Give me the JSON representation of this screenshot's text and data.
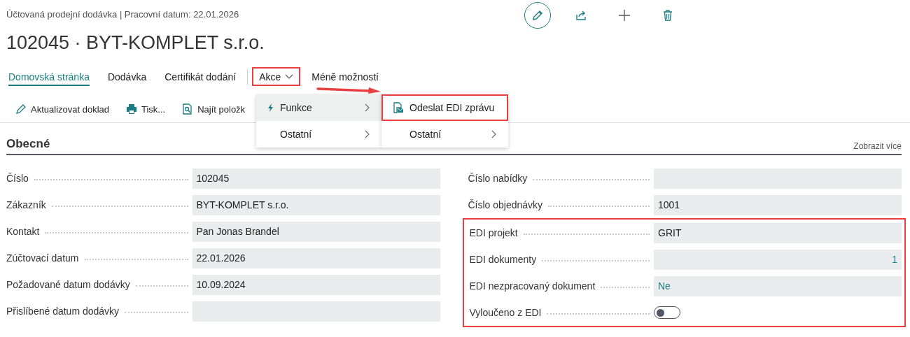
{
  "header": {
    "subtitle": "Účtovaná prodejní dodávka | Pracovní datum: 22.01.2026",
    "title": "102045 · BYT-KOMPLET s.r.o.",
    "tools": [
      {
        "kind": "edit",
        "selected": true
      },
      {
        "kind": "share",
        "selected": false
      },
      {
        "kind": "add",
        "selected": false
      },
      {
        "kind": "delete",
        "selected": false
      }
    ]
  },
  "tabs": [
    {
      "label": "Domovská stránka",
      "selected": true,
      "highlighted": false,
      "kind": "tab"
    },
    {
      "label": "Dodávka",
      "selected": false,
      "highlighted": false,
      "kind": "tab"
    },
    {
      "label": "Certifikát dodání",
      "selected": false,
      "highlighted": false,
      "kind": "tab"
    },
    {
      "label": "Akce",
      "selected": false,
      "highlighted": true,
      "kind": "dropdown"
    },
    {
      "label": "Méně možností",
      "selected": false,
      "highlighted": false,
      "kind": "tab"
    }
  ],
  "actions": [
    {
      "label": "Aktualizovat doklad",
      "kind": "edit"
    },
    {
      "label": "Tisk...",
      "kind": "print"
    },
    {
      "label": "Najít položk",
      "kind": "find"
    }
  ],
  "menu": [
    {
      "label": "Funkce",
      "kind": "function",
      "selected": true
    },
    {
      "label": "Ostatní",
      "kind": "group",
      "selected": false
    }
  ],
  "submenu": [
    {
      "label": "Odeslat EDI zprávu",
      "kind": "command",
      "highlighted": true
    },
    {
      "label": "Ostatní",
      "kind": "group",
      "highlighted": false
    }
  ],
  "section": {
    "title": "Obecné",
    "more_link": "Zobrazit více"
  },
  "left_fields": [
    {
      "label": "Číslo",
      "value": "102045",
      "kind": "text"
    },
    {
      "label": "Zákazník",
      "value": "BYT-KOMPLET s.r.o.",
      "kind": "text"
    },
    {
      "label": "Kontakt",
      "value": "Pan Jonas Brandel",
      "kind": "text"
    },
    {
      "label": "Zúčtovací datum",
      "value": "22.01.2026",
      "kind": "text"
    },
    {
      "label": "Požadované datum dodávky",
      "value": "10.09.2024",
      "kind": "text"
    },
    {
      "label": "Přislíbené datum dodávky",
      "kind": "text"
    }
  ],
  "right_fields": [
    {
      "label": "Číslo nabídky",
      "kind": "text"
    },
    {
      "label": "Číslo objednávky",
      "value": "1001",
      "kind": "text"
    }
  ],
  "edi_group": {
    "highlighted": true,
    "fields": [
      {
        "label": "EDI projekt",
        "value": "GRIT",
        "kind": "text"
      },
      {
        "label": "EDI dokumenty",
        "value": "1",
        "kind": "number"
      },
      {
        "label": "EDI nezpracovaný dokument",
        "value": "Ne",
        "kind": "flag"
      },
      {
        "label": "Vyloučeno z EDI",
        "kind": "toggle",
        "on": false
      }
    ]
  }
}
